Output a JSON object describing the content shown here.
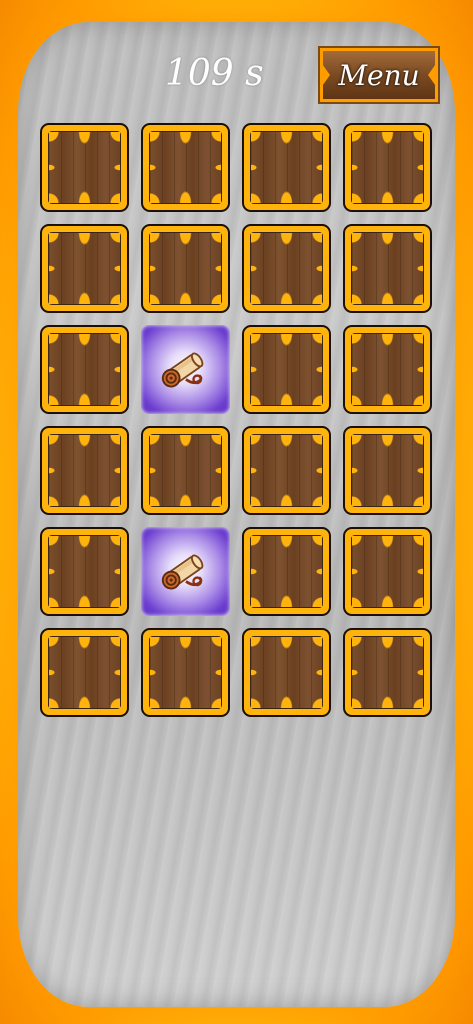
{
  "hud": {
    "timer_text": "109 s",
    "menu_label": "Menu"
  },
  "board": {
    "rows": 6,
    "cols": 4,
    "cards": [
      {
        "state": "down"
      },
      {
        "state": "down"
      },
      {
        "state": "down"
      },
      {
        "state": "down"
      },
      {
        "state": "down"
      },
      {
        "state": "down"
      },
      {
        "state": "down"
      },
      {
        "state": "down"
      },
      {
        "state": "down"
      },
      {
        "state": "up",
        "icon": "scroll-icon"
      },
      {
        "state": "down"
      },
      {
        "state": "down"
      },
      {
        "state": "down"
      },
      {
        "state": "down"
      },
      {
        "state": "down"
      },
      {
        "state": "down"
      },
      {
        "state": "down"
      },
      {
        "state": "up",
        "icon": "scroll-icon"
      },
      {
        "state": "down"
      },
      {
        "state": "down"
      },
      {
        "state": "down"
      },
      {
        "state": "down"
      },
      {
        "state": "down"
      },
      {
        "state": "down"
      }
    ]
  },
  "colors": {
    "frame": "#ffc20f",
    "card_border": "#ffb30d",
    "card_wood": "#6b4122",
    "revealed_glow": "#6d3fd0"
  }
}
